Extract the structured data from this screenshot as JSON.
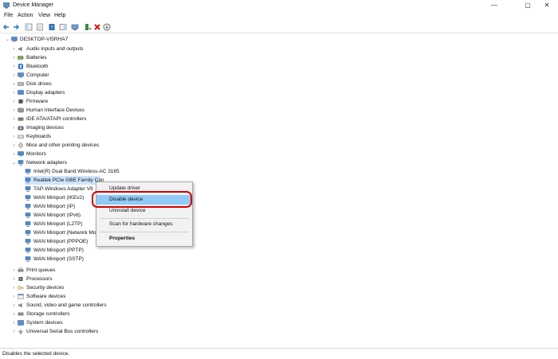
{
  "window": {
    "title": "Device Manager",
    "controls": [
      "—",
      "▢",
      "✕"
    ]
  },
  "menu": [
    "File",
    "Action",
    "View",
    "Help"
  ],
  "tree": {
    "root": "DESKTOP-VI5RHA7",
    "categories_before": [
      "Audio inputs and outputs",
      "Batteries",
      "Bluetooth",
      "Computer",
      "Disk drives",
      "Display adapters",
      "Firmware",
      "Human Interface Devices",
      "IDE ATA/ATAPI controllers",
      "Imaging devices",
      "Keyboards",
      "Mice and other pointing devices",
      "Monitors"
    ],
    "network": {
      "label": "Network adapters",
      "children": [
        "Intel(R) Dual Band Wireless-AC 3165",
        "Realtek PCIe GBE Family Con",
        "TAP-Windows Adapter V9",
        "WAN Miniport (IKEv2)",
        "WAN Miniport (IP)",
        "WAN Miniport (IPv6)",
        "WAN Miniport (L2TP)",
        "WAN Miniport (Network Mo",
        "WAN Miniport (PPPOE)",
        "WAN Miniport (PPTP)",
        "WAN Miniport (SSTP)"
      ]
    },
    "categories_after": [
      "Print queues",
      "Processors",
      "Security devices",
      "Software devices",
      "Sound, video and game controllers",
      "Storage controllers",
      "System devices",
      "Universal Serial Bus controllers"
    ]
  },
  "context_menu": {
    "update": "Update driver",
    "disable": "Disable device",
    "uninstall": "Uninstall device",
    "scan": "Scan for hardware changes",
    "properties": "Properties"
  },
  "status": "Disables the selected device.",
  "colors": {
    "highlight": "#91c9f7",
    "annotation": "#d40000",
    "selection": "#cfe5fb"
  }
}
